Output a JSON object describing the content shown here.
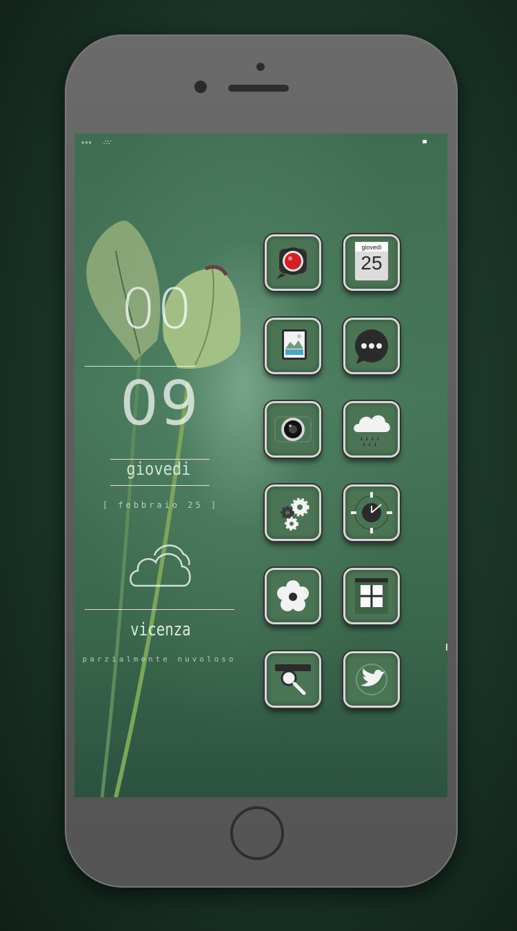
{
  "status_bar": {
    "left_icons": [
      "signal-icon",
      "carrier-icon"
    ],
    "right_icon": "battery-icon"
  },
  "widget": {
    "hour": "00",
    "minute": "09",
    "weekday": "giovedi",
    "date": "[ febbraio 25 ]",
    "weather_icon": "cloud-icon",
    "city": "vicenza",
    "condition": "parzialmente nuvoloso"
  },
  "apps": [
    {
      "name": "video-recorder",
      "icon": "record-icon"
    },
    {
      "name": "calendar",
      "icon": "calendar-icon",
      "day_label": "giovedì",
      "date_number": "25"
    },
    {
      "name": "photos",
      "icon": "photo-icon"
    },
    {
      "name": "messages",
      "icon": "chat-bubble-icon"
    },
    {
      "name": "camera",
      "icon": "camera-icon"
    },
    {
      "name": "weather",
      "icon": "rain-cloud-icon"
    },
    {
      "name": "settings",
      "icon": "gears-icon"
    },
    {
      "name": "clock",
      "icon": "clock-icon"
    },
    {
      "name": "flower-app",
      "icon": "flower-icon"
    },
    {
      "name": "window-app",
      "icon": "window-icon"
    },
    {
      "name": "search",
      "icon": "magnifier-icon"
    },
    {
      "name": "twitter",
      "icon": "bird-icon"
    }
  ],
  "colors": {
    "screen_green": "#47775a",
    "icon_green": "#4b7455",
    "phone_body": "#5d5d5d",
    "record_red": "#d61f26"
  }
}
